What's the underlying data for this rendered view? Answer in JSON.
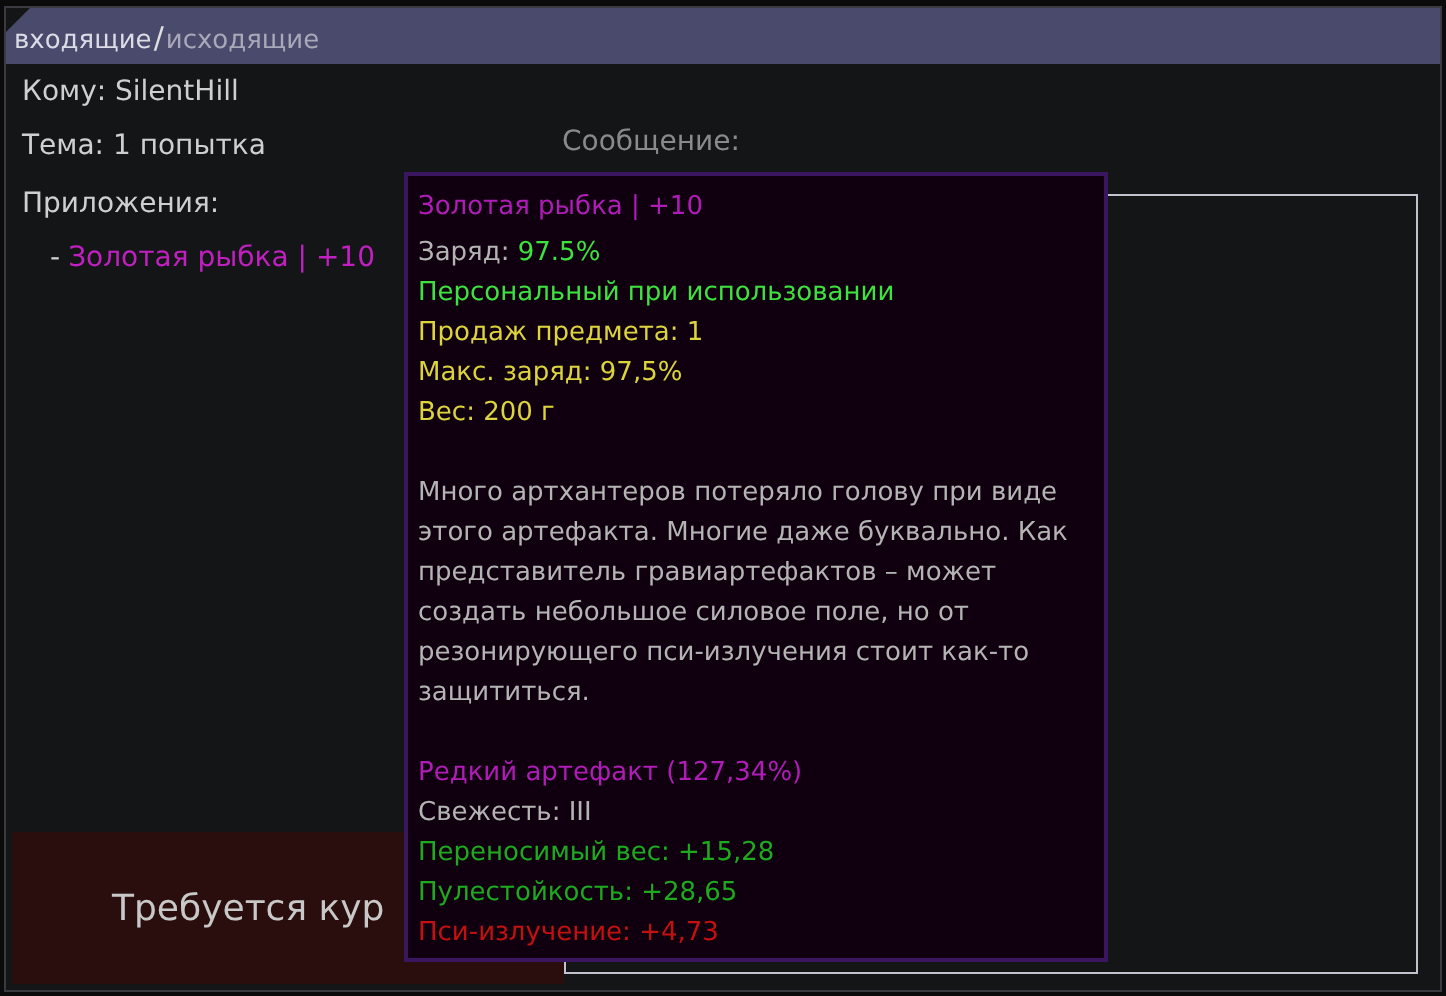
{
  "header": {
    "tabs": [
      {
        "label": "входящие",
        "selected": true
      },
      {
        "label": "исходящие",
        "selected": false
      }
    ],
    "separator": "/"
  },
  "fields": [
    {
      "text": "Кому: SilentHill"
    },
    {
      "text": "Тема: 1 попытка"
    }
  ],
  "attachments": {
    "label": "Приложения:",
    "items": [
      {
        "bullet": "-",
        "name": "Золотая рыбка | +10"
      }
    ]
  },
  "message": {
    "label": "Сообщение:"
  },
  "banner": {
    "text": "Требуется кур"
  },
  "tooltip": {
    "title": "Золотая рыбка | +10",
    "sections": [
      [
        {
          "kind": "pair",
          "label": "Заряд: ",
          "value": "97.5%",
          "color": "#3ee23e"
        },
        {
          "kind": "line",
          "text": "Персональный при использовании",
          "color": "#3ee23e"
        },
        {
          "kind": "line",
          "text": "Продаж предмета: 1",
          "color": "#dcd43c"
        },
        {
          "kind": "line",
          "text": "Макс. заряд: 97,5%",
          "color": "#dcd43c"
        },
        {
          "kind": "line",
          "text": "Вес: 200 г",
          "color": "#dcd43c"
        }
      ],
      [
        {
          "kind": "line",
          "text": "Много артхантеров потеряло голову при виде этого артефакта. Многие даже буквально. Как представитель гравиартефактов – может создать небольшое силовое поле, но от резонирующего пси-излучения стоит как-то защититься.",
          "color": "#b4b4b4"
        }
      ],
      [
        {
          "kind": "line",
          "text": "Редкий артефакт (127,34%)",
          "color": "#b01cb8"
        },
        {
          "kind": "line",
          "text": "Свежесть: III",
          "color": "#b4b4b4"
        },
        {
          "kind": "line",
          "text": "Переносимый вес: +15,28",
          "color": "#1eaa1e"
        },
        {
          "kind": "line",
          "text": "Пулестойкость: +28,65",
          "color": "#1eaa1e"
        },
        {
          "kind": "line",
          "text": "Пси-излучение: +4,73",
          "color": "#c41010"
        }
      ]
    ]
  }
}
